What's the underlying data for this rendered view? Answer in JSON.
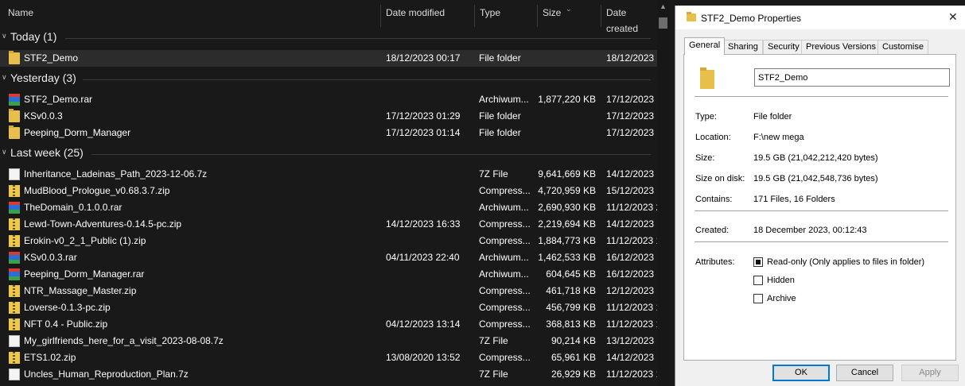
{
  "columns": {
    "name": "Name",
    "date_modified": "Date modified",
    "type": "Type",
    "size": "Size",
    "date_created": "Date created"
  },
  "groups": [
    {
      "title": "Today (1)",
      "rows": [
        {
          "name": "STF2_Demo",
          "date": "18/12/2023 00:17",
          "type": "File folder",
          "size": "",
          "created": "18/12/2023 (",
          "icon": "folder-icon",
          "selected": true
        }
      ]
    },
    {
      "title": "Yesterday (3)",
      "rows": [
        {
          "name": "STF2_Demo.rar",
          "date": "",
          "type": "Archiwum...",
          "size": "1,877,220 KB",
          "created": "17/12/2023 2",
          "icon": "rar-archive-icon"
        },
        {
          "name": "KSv0.0.3",
          "date": "17/12/2023 01:29",
          "type": "File folder",
          "size": "",
          "created": "17/12/2023 (",
          "icon": "folder-icon"
        },
        {
          "name": "Peeping_Dorm_Manager",
          "date": "17/12/2023 01:14",
          "type": "File folder",
          "size": "",
          "created": "17/12/2023 (",
          "icon": "folder-icon"
        }
      ]
    },
    {
      "title": "Last week (25)",
      "rows": [
        {
          "name": "Inheritance_Ladeinas_Path_2023-12-06.7z",
          "date": "",
          "type": "7Z File",
          "size": "9,641,669 KB",
          "created": "14/12/2023 (",
          "icon": "file-icon"
        },
        {
          "name": "MudBlood_Prologue_v0.68.3.7.zip",
          "date": "",
          "type": "Compress...",
          "size": "4,720,959 KB",
          "created": "15/12/2023 (",
          "icon": "zip-archive-icon"
        },
        {
          "name": "TheDomain_0.1.0.0.rar",
          "date": "",
          "type": "Archiwum...",
          "size": "2,690,930 KB",
          "created": "11/12/2023 2",
          "icon": "rar-archive-icon"
        },
        {
          "name": "Lewd-Town-Adventures-0.14.5-pc.zip",
          "date": "14/12/2023 16:33",
          "type": "Compress...",
          "size": "2,219,694 KB",
          "created": "14/12/2023 1",
          "icon": "zip-archive-icon"
        },
        {
          "name": "Erokin-v0_2_1_Public (1).zip",
          "date": "",
          "type": "Compress...",
          "size": "1,884,773 KB",
          "created": "11/12/2023 1",
          "icon": "zip-archive-icon"
        },
        {
          "name": "KSv0.0.3.rar",
          "date": "04/11/2023 22:40",
          "type": "Archiwum...",
          "size": "1,462,533 KB",
          "created": "16/12/2023 2",
          "icon": "rar-archive-icon"
        },
        {
          "name": "Peeping_Dorm_Manager.rar",
          "date": "",
          "type": "Archiwum...",
          "size": "604,645 KB",
          "created": "16/12/2023 2",
          "icon": "rar-archive-icon"
        },
        {
          "name": "NTR_Massage_Master.zip",
          "date": "",
          "type": "Compress...",
          "size": "461,718 KB",
          "created": "12/12/2023 1",
          "icon": "zip-archive-icon"
        },
        {
          "name": "Loverse-0.1.3-pc.zip",
          "date": "",
          "type": "Compress...",
          "size": "456,799 KB",
          "created": "11/12/2023 1",
          "icon": "zip-archive-icon"
        },
        {
          "name": "NFT 0.4 - Public.zip",
          "date": "04/12/2023 13:14",
          "type": "Compress...",
          "size": "368,813 KB",
          "created": "11/12/2023 1",
          "icon": "zip-archive-icon"
        },
        {
          "name": "My_girlfriends_here_for_a_visit_2023-08-08.7z",
          "date": "",
          "type": "7Z File",
          "size": "90,214 KB",
          "created": "13/12/2023 1",
          "icon": "file-icon"
        },
        {
          "name": "ETS1.02.zip",
          "date": "13/08/2020 13:52",
          "type": "Compress...",
          "size": "65,961 KB",
          "created": "14/12/2023 2",
          "icon": "zip-archive-icon"
        },
        {
          "name": "Uncles_Human_Reproduction_Plan.7z",
          "date": "",
          "type": "7Z File",
          "size": "26,929 KB",
          "created": "11/12/2023 1",
          "icon": "file-icon"
        }
      ]
    }
  ],
  "dialog": {
    "title": "STF2_Demo Properties",
    "tabs": [
      "General",
      "Sharing",
      "Security",
      "Previous Versions",
      "Customise"
    ],
    "active_tab": "General",
    "name_value": "STF2_Demo",
    "props": [
      {
        "label": "Type:",
        "value": "File folder"
      },
      {
        "label": "Location:",
        "value": "F:\\new mega"
      },
      {
        "label": "Size:",
        "value": "19.5 GB (21,042,212,420 bytes)"
      },
      {
        "label": "Size on disk:",
        "value": "19.5 GB (21,042,548,736 bytes)"
      },
      {
        "label": "Contains:",
        "value": "171 Files, 16 Folders"
      },
      {
        "label": "Created:",
        "value": "18 December 2023, 00:12:43"
      }
    ],
    "attributes_label": "Attributes:",
    "attributes": [
      {
        "label": "Read-only (Only applies to files in folder)",
        "checked": true
      },
      {
        "label": "Hidden",
        "checked": false
      },
      {
        "label": "Archive",
        "checked": false
      }
    ],
    "buttons": {
      "ok": "OK",
      "cancel": "Cancel",
      "apply": "Apply"
    }
  }
}
